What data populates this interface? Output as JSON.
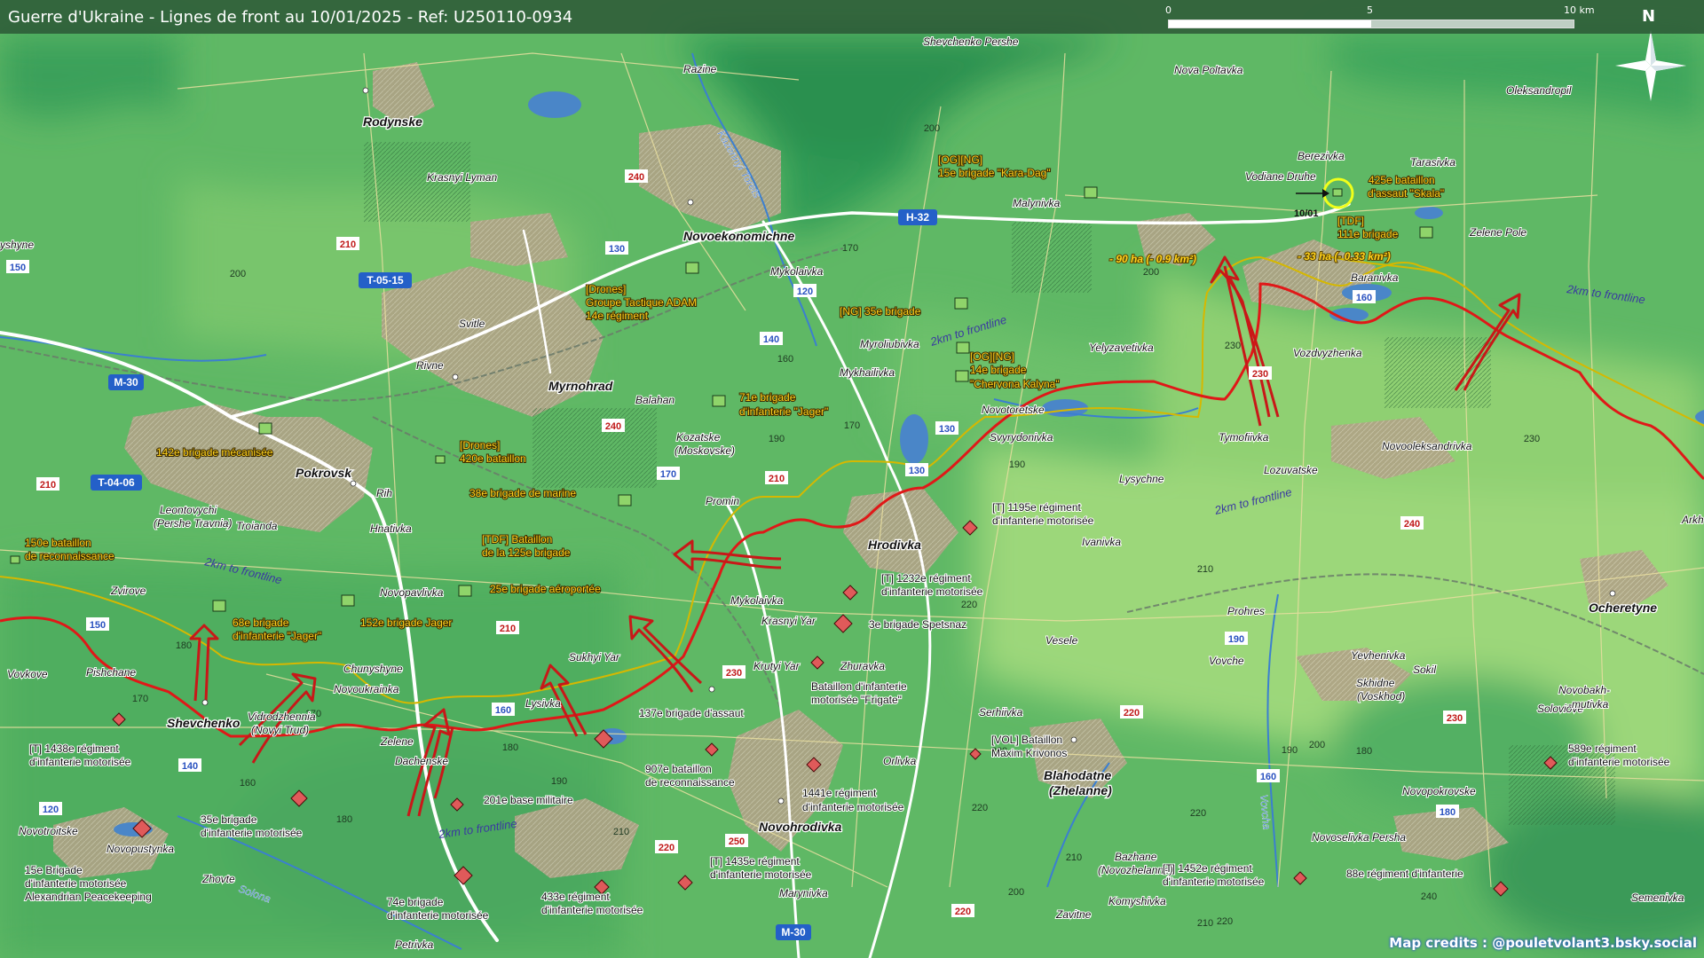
{
  "header": {
    "title": "Guerre d'Ukraine - Lignes de front au 10/01/2025 - Ref: U250110-0934"
  },
  "scale": {
    "labels": [
      "0",
      "5",
      "10 km"
    ]
  },
  "compass": {
    "label": "N"
  },
  "credits": {
    "text": "Map credits : @pouletvolant3.bsky.social"
  },
  "towns_major": [
    "Rodynske",
    "Novoekonomichne",
    "Myrnohrad",
    "Pokrovsk",
    "Hrodivka",
    "Shevchenko",
    "Novohrodivka",
    "Blahodatne",
    "(Zhelanne)",
    "Ocheretyne"
  ],
  "villages": [
    "Razine",
    "Shevchenko Pershe",
    "Nova Poltavka",
    "Oleksandropil",
    "Berezivka",
    "Tarasivka",
    "Vodiane Druhe",
    "Malynivka",
    "Zelene Pole",
    "Krasnyi Lyman",
    "Mykolaivka",
    "Baranivka",
    "Svitle",
    "Rivne",
    "Myroliubivka",
    "Mykhailivka",
    "Vozdvyzhenka",
    "Yelyzavetivka",
    "Balahan",
    "Kozatske",
    "(Moskovske)",
    "Novotoretske",
    "Svyrydonivka",
    "Tymofiivka",
    "Novooleksandrivka",
    "Lozuvatske",
    "Lysychne",
    "Rih",
    "Hnativka",
    "Leontovychi",
    "(Pershe Travnia)",
    "Troianda",
    "Promin",
    "Ivanivka",
    "Zvirove",
    "Novopavlivka",
    "Mykolaivka",
    "Krasnyi Yar",
    "Krutyi Yar",
    "Zhuravka",
    "Vesele",
    "Prohres",
    "Vovkove",
    "Pishchane",
    "Chunyshyne",
    "Novoukrainka",
    "Sukhyi Yar",
    "Lysivka",
    "Vidrodzhennia",
    "(Novyi Trud)",
    "Zelene",
    "Dachenske",
    "Vovche",
    "Yevhenivka",
    "Sokil",
    "Skhidne",
    "(Voskhod)",
    "Soloviove",
    "Novobakh-",
    "-mutivka",
    "Novopokrovske",
    "Serhiivka",
    "Orlivka",
    "Novotroitske",
    "Novopustynka",
    "Zhovte",
    "Novoselivka Persha",
    "Bazhane",
    "(Novozhelanne)",
    "Komyshivka",
    "Marynivka",
    "Zavitne",
    "Petrivka",
    "Semenivka",
    "Arkh",
    "yshyne"
  ],
  "river_labels": [
    "Kazennyi Torets",
    "Solona",
    "Vovcha"
  ],
  "road_labels": [
    "H-32",
    "T-05-15",
    "M-30",
    "T-04-06",
    "M-30"
  ],
  "road_numbers": [
    "130",
    "120",
    "140",
    "150",
    "150",
    "170",
    "160",
    "160",
    "190",
    "160",
    "180",
    "140",
    "120",
    "130",
    "130"
  ],
  "road_numbers_red": [
    "240",
    "240",
    "210",
    "210",
    "210",
    "210",
    "230",
    "230",
    "250",
    "220",
    "220",
    "230",
    "240",
    "220"
  ],
  "elevations": [
    "200",
    "170",
    "160",
    "190",
    "170",
    "180",
    "200",
    "220",
    "230",
    "210",
    "190",
    "200",
    "190",
    "180",
    "160",
    "180",
    "170",
    "190",
    "210",
    "220",
    "180",
    "170",
    "200",
    "220",
    "210",
    "200",
    "210",
    "220",
    "220",
    "230",
    "240"
  ],
  "frontline_note": "2km to frontline",
  "area_changes": [
    {
      "label": "- 90 ha (- 0.9 km²)"
    },
    {
      "label": "- 33 ha (- 0.33 km²)"
    }
  ],
  "date_marker": "10/01",
  "ukr_units": [
    "[OG][NG]",
    "15e brigade \"Kara-Dag\"",
    "425e bataillon",
    "d'assaut \"Skala\"",
    "[TDF]",
    "111e brigade",
    "[Drones]",
    "Groupe Tactique ADAM",
    "14e régiment",
    "[NG] 35e brigade",
    "[OG][NG]",
    "14e brigade",
    "\"Chervona Kalyna\"",
    "71e brigade",
    "d'infanterie \"Jager\"",
    "142e brigade mécanisée",
    "[Drones]",
    "420e bataillon",
    "38e brigade de marine",
    "[TDF] Bataillon",
    "de la 125e brigade",
    "150e bataillon",
    "de reconnaissance",
    "25e brigade aéroportée",
    "68e brigade",
    "d'infanterie \"Jager\"",
    "152e brigade Jager"
  ],
  "rus_units": [
    "[T] 1195e régiment",
    "d'infanterie motorisée",
    "[T] 1232e régiment",
    "d'infanterie motorisée",
    "3e brigade Spetsnaz",
    "Bataillon d'infanterie",
    "motorisée \"Frigate\"",
    "137e brigade d'assaut",
    "907e bataillon",
    "de reconnaissance",
    "1441e régiment",
    "d'infanterie motorisée",
    "201e base militaire",
    "[T] 1438e régiment",
    "d'infanterie motorisée",
    "35e brigade",
    "d'infanterie motorisée",
    "[VOL] Bataillon",
    "Maxim Krivonos",
    "589e régiment",
    "d'infanterie motorisée",
    "15e Brigade",
    "d'infanterie motorisée",
    "Alexandrian Peacekeeping",
    "74e brigade",
    "d'infanterie motorisée",
    "433e régiment",
    "d'infanterie motorisée",
    "[T] 1435e régiment",
    "d'infanterie motorisée",
    "[T] 1452e régiment",
    "d'infanterie motorisée",
    "88e régiment d'infanterie"
  ],
  "colors": {
    "background": "#5fb865",
    "frontline": "#e01818",
    "previous_line": "#d6b800",
    "ukr_symbol": "#8fd46a",
    "rus_symbol": "#e05a5a",
    "ukr_label": "#ffd21e",
    "road_major": "#ffffff",
    "water": "#4a86c8",
    "urban": "#b4a48a"
  }
}
